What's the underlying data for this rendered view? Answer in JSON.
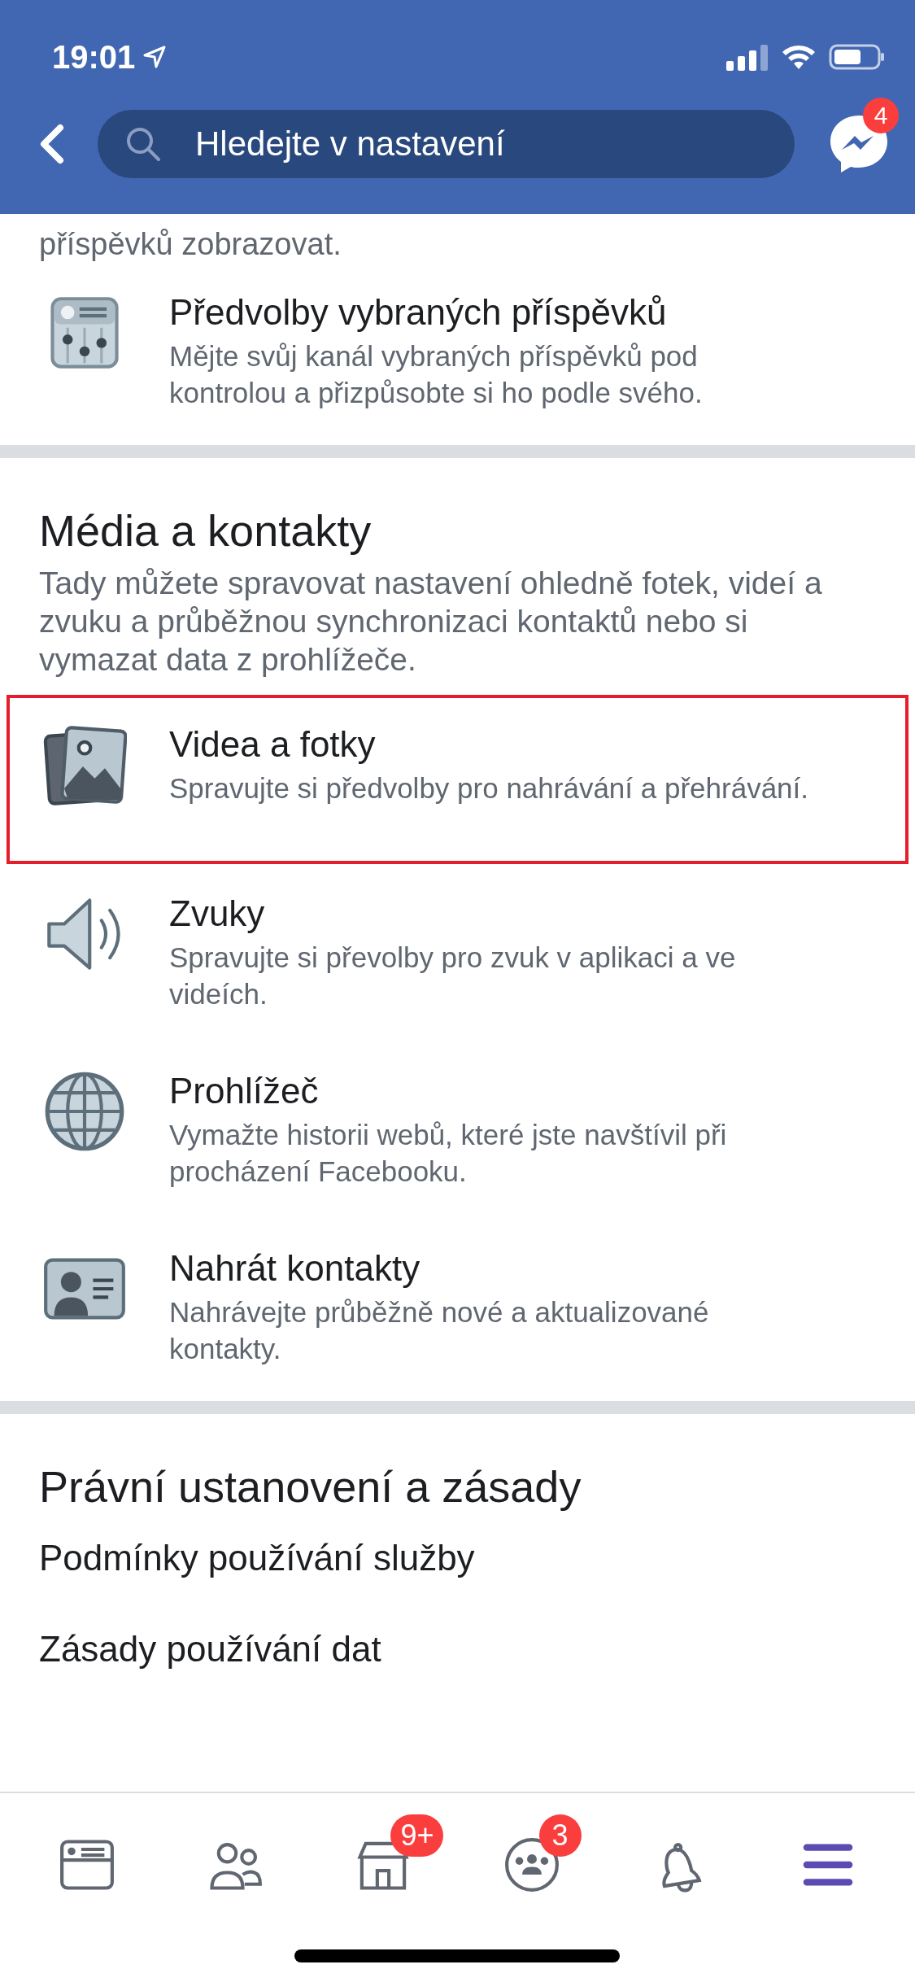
{
  "status_bar": {
    "time": "19:01"
  },
  "nav_bar": {
    "search": {
      "placeholder": "Hledejte v nastavení"
    },
    "messenger_badge": "4"
  },
  "intro_tail": "příspěvků zobrazovat.",
  "top_items": [
    {
      "title": "Předvolby vybraných příspěvků",
      "subtitle": "Mějte svůj kanál vybraných příspěvků pod kontrolou a přizpůsobte si ho podle svého.",
      "highlighted": false
    }
  ],
  "sections": [
    {
      "title": "Média a kontakty",
      "description": "Tady můžete spravovat nastavení ohledně fotek, videí a zvuku a průběžnou synchronizaci kontaktů nebo si vymazat data z prohlížeče.",
      "items": [
        {
          "title": "Videa a fotky",
          "subtitle": "Spravujte si předvolby pro nahrávání a přehrávání.",
          "highlighted": true
        },
        {
          "title": "Zvuky",
          "subtitle": "Spravujte si převolby pro zvuk v aplikaci a ve videích.",
          "highlighted": false
        },
        {
          "title": "Prohlížeč",
          "subtitle": "Vymažte historii webů, které jste navštívil při procházení Facebooku.",
          "highlighted": false
        },
        {
          "title": "Nahrát kontakty",
          "subtitle": "Nahrávejte průběžně nové a aktualizované kontakty.",
          "highlighted": false
        }
      ]
    },
    {
      "title": "Právní ustanovení a zásady",
      "links": [
        "Podmínky používání služby",
        "Zásady používání dat"
      ]
    }
  ],
  "tab_bar": [
    {
      "selected": false
    },
    {
      "selected": false
    },
    {
      "selected": false,
      "badge": "9+"
    },
    {
      "selected": false,
      "badge": "3"
    },
    {
      "selected": false
    },
    {
      "selected": true
    }
  ]
}
